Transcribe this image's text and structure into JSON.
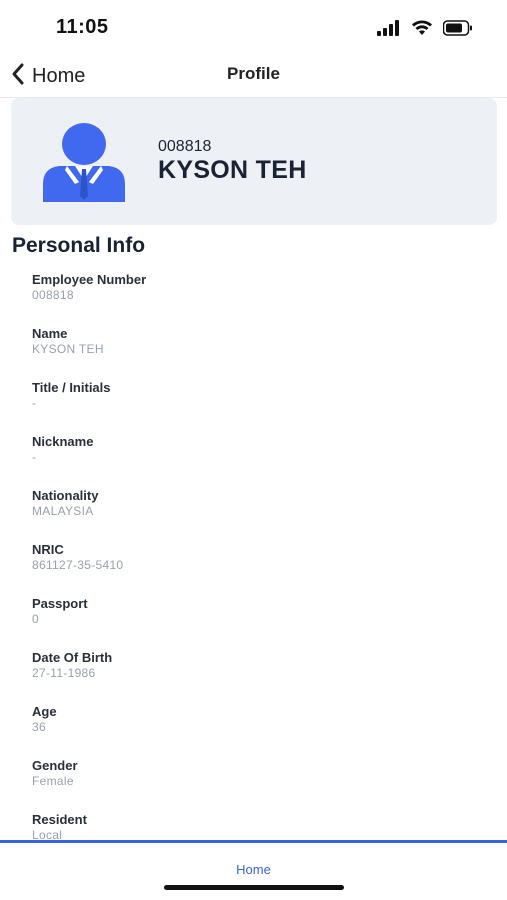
{
  "status_bar": {
    "time": "11:05"
  },
  "nav": {
    "back_label": "Home",
    "title": "Profile"
  },
  "profile": {
    "employee_number": "008818",
    "name": "KYSON TEH"
  },
  "section": {
    "title": "Personal Info"
  },
  "info_fields": [
    {
      "label": "Employee Number",
      "value": "008818"
    },
    {
      "label": "Name",
      "value": "KYSON TEH"
    },
    {
      "label": "Title / Initials",
      "value": "-"
    },
    {
      "label": "Nickname",
      "value": "-"
    },
    {
      "label": "Nationality",
      "value": "MALAYSIA"
    },
    {
      "label": "NRIC",
      "value": "861127-35-5410"
    },
    {
      "label": "Passport",
      "value": "0"
    },
    {
      "label": "Date Of Birth",
      "value": "27-11-1986"
    },
    {
      "label": "Age",
      "value": "36"
    },
    {
      "label": "Gender",
      "value": "Female"
    },
    {
      "label": "Resident",
      "value": "Local"
    }
  ],
  "tab_bar": {
    "home_label": "Home"
  },
  "colors": {
    "accent": "#3a63e0",
    "avatar_blue": "#4169f0",
    "card_bg": "#edf0f5"
  },
  "icons": {
    "back": "chevron-left-icon",
    "avatar": "user-avatar-icon",
    "signal": "signal-icon",
    "wifi": "wifi-icon",
    "battery": "battery-icon"
  }
}
